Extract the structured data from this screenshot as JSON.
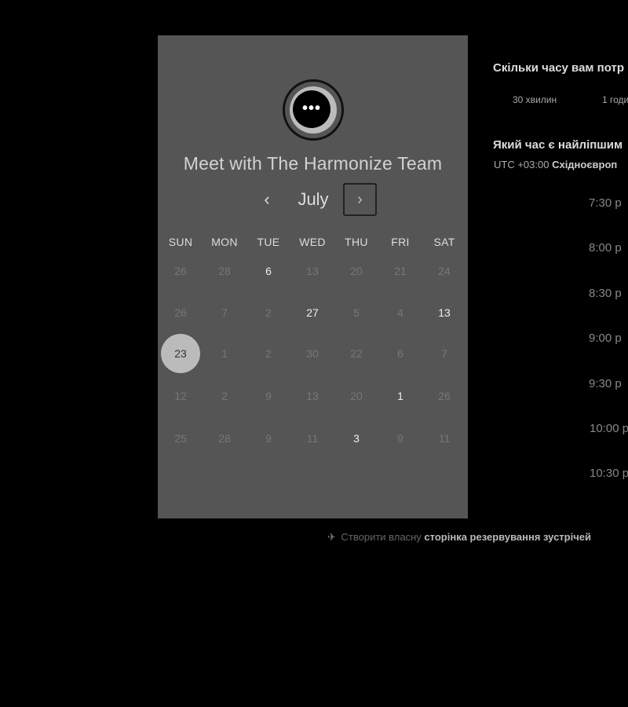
{
  "booking": {
    "title": "Meet with The Harmonize Team",
    "month": "July",
    "prev_label": "‹",
    "next_label": "›",
    "logo_dots": "•••",
    "weekdays": [
      "SUN",
      "MON",
      "TUE",
      "WED",
      "THU",
      "FRI",
      "SAT"
    ],
    "weeks": [
      [
        "26",
        "28",
        "6",
        "13",
        "20",
        "21",
        "24"
      ],
      [
        "26",
        "7",
        "2",
        "27",
        "5",
        "4",
        "13"
      ],
      [
        "23",
        "1",
        "2",
        "30",
        "22",
        "6",
        "7"
      ],
      [
        "12",
        "2",
        "9",
        "13",
        "20",
        "1",
        "26"
      ],
      [
        "25",
        "28",
        "9",
        "11",
        "3",
        "9",
        "11"
      ]
    ],
    "available": [
      [
        0,
        2
      ],
      [
        1,
        3
      ],
      [
        1,
        6
      ],
      [
        2,
        0
      ],
      [
        3,
        5
      ],
      [
        4,
        4
      ]
    ],
    "selected": [
      2,
      0
    ]
  },
  "right_panel": {
    "duration_question": "Скільки часу вам потр",
    "durations": [
      "30 хвилин",
      "1 годи"
    ],
    "time_question": "Який час є найліпшим",
    "timezone_prefix": "UTC +03:00",
    "timezone_name": "Східноєвроп",
    "slots": [
      "7:30 p",
      "8:00 p",
      "8:30 p",
      "9:00 p",
      "9:30 p",
      "10:00 p",
      "10:30 p"
    ]
  },
  "footer": {
    "icon": "✈",
    "prefix": "Створити власну",
    "link": "сторінка резервування зустрічей"
  },
  "colors": {
    "page_background": "#000000",
    "card_background": "#555555",
    "selected_day": "#bbbbbb"
  },
  "icons": {
    "prev": "chevron-left-icon",
    "next": "chevron-right-icon",
    "logo": "chat-bubble-logo",
    "footer": "scheduling-icon"
  }
}
